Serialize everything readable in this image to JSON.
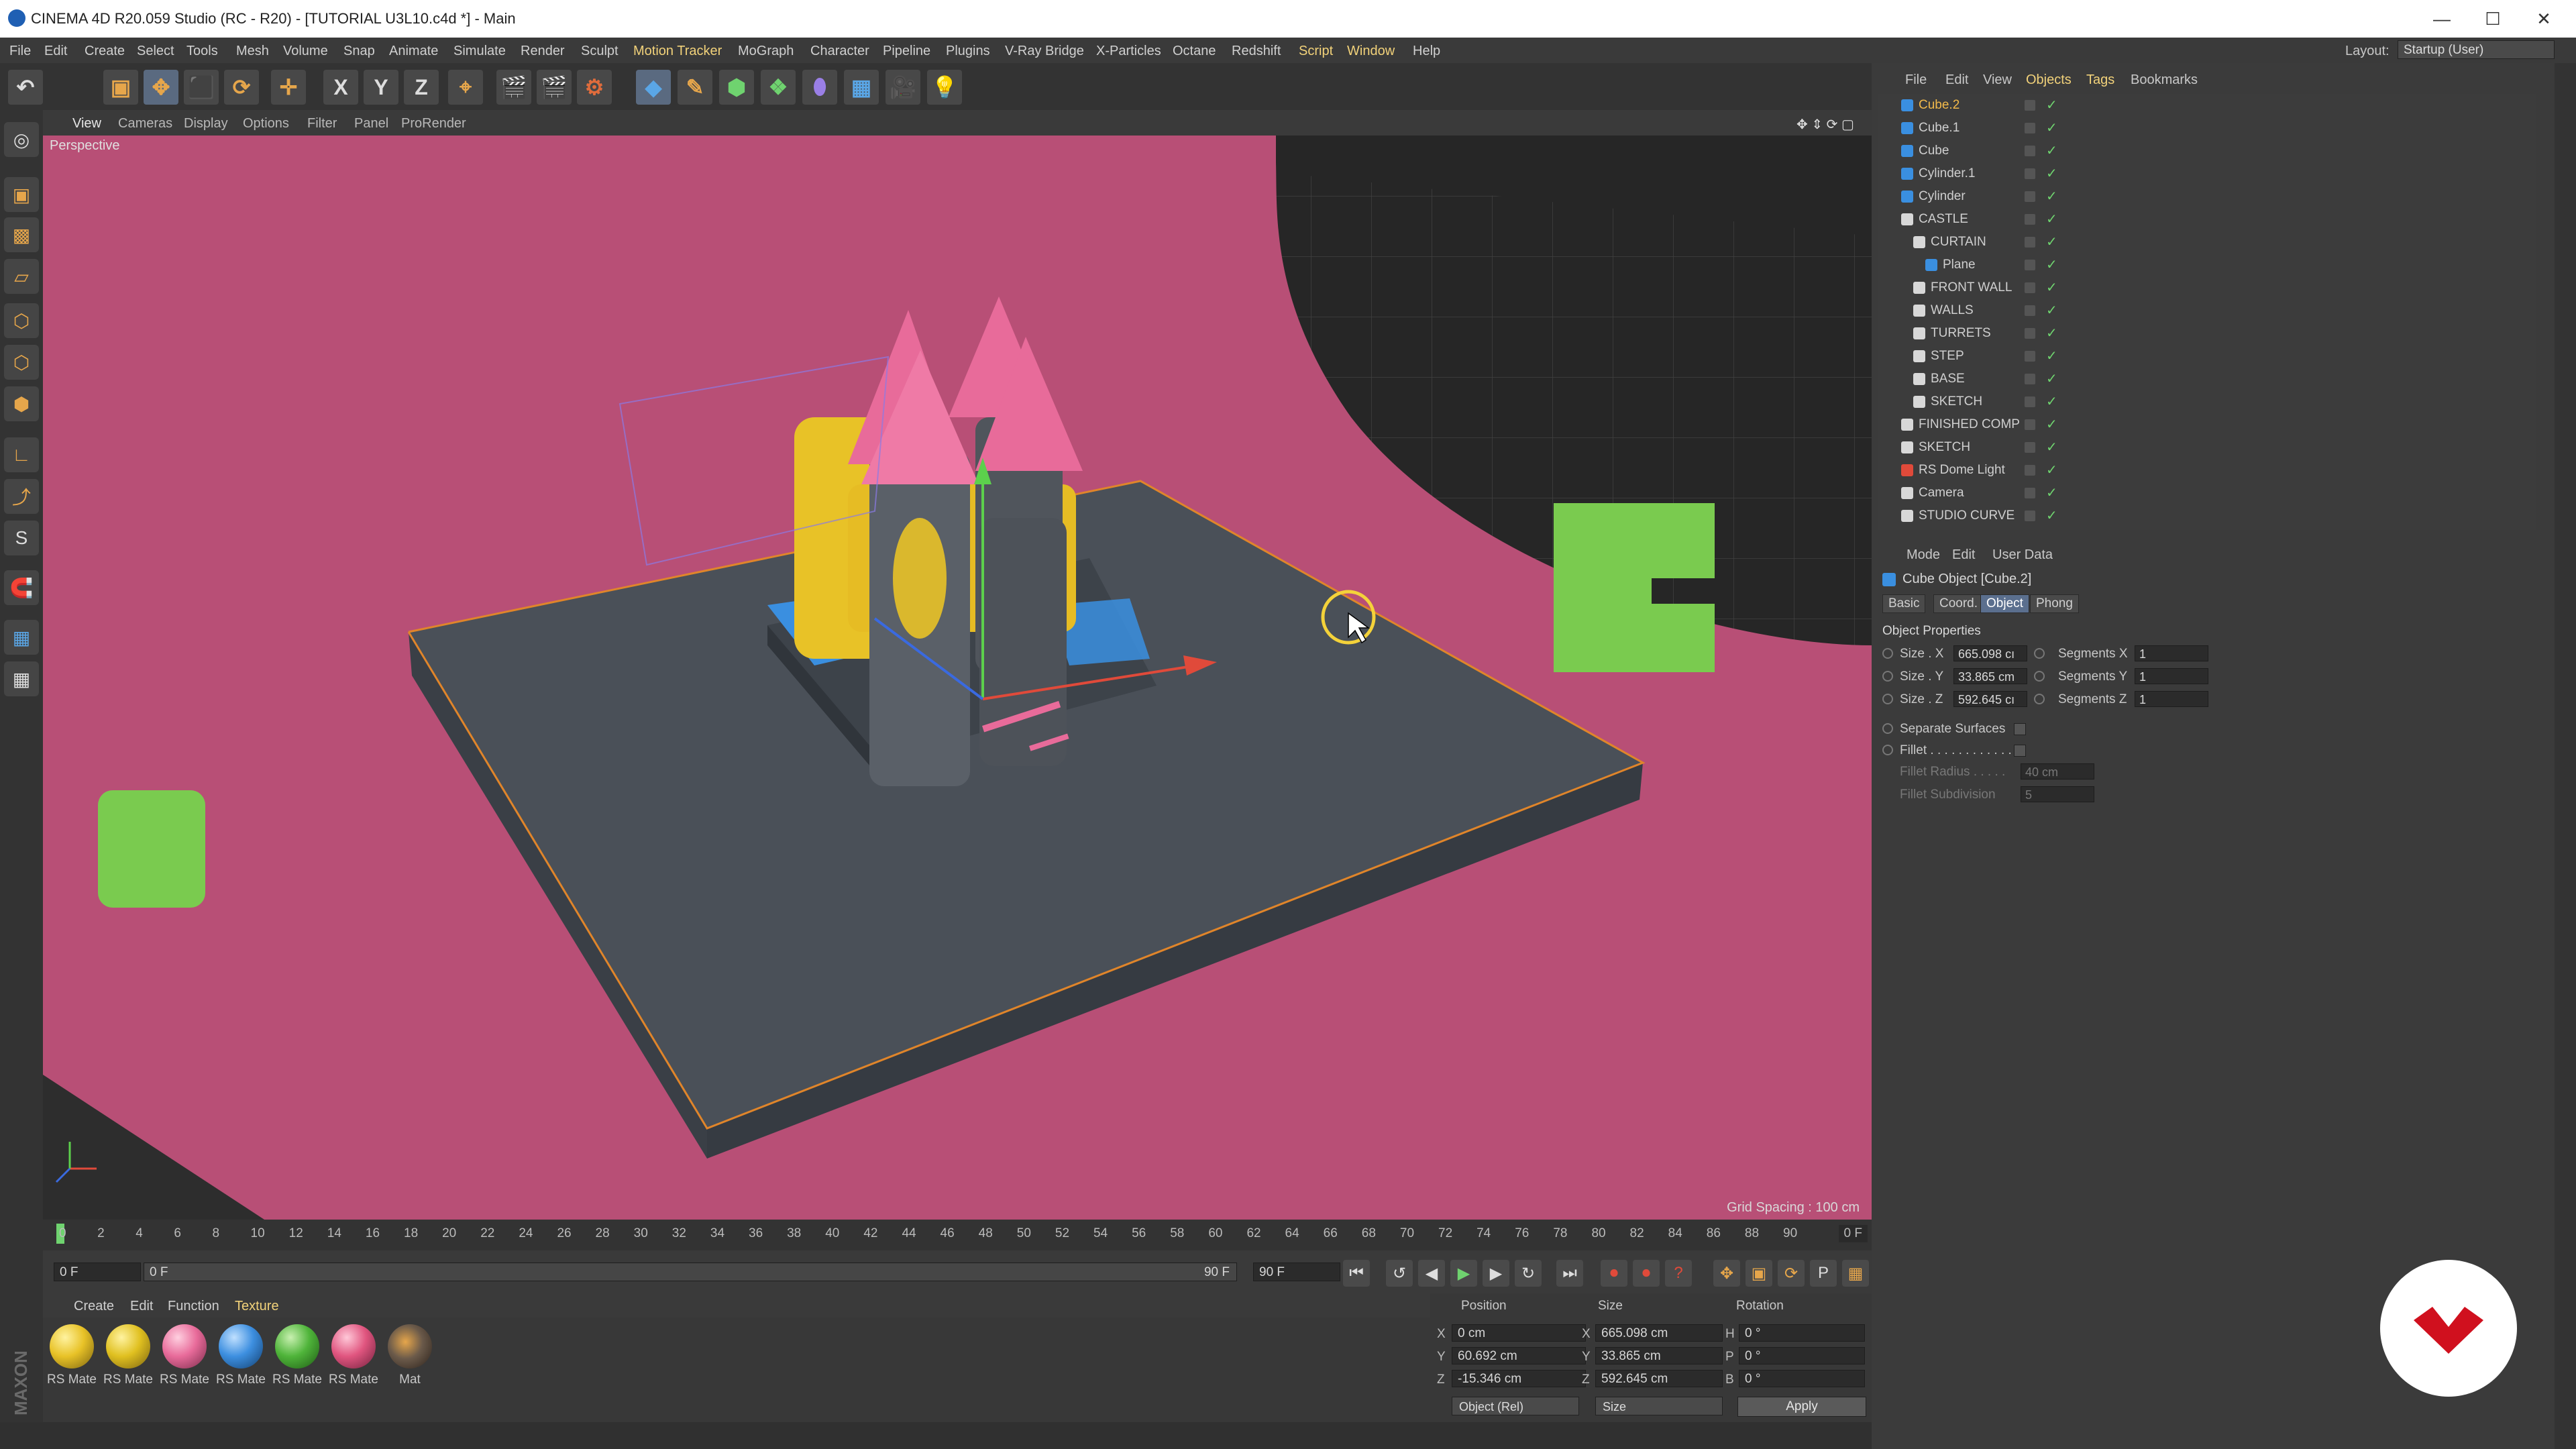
{
  "window": {
    "title": "CINEMA 4D R20.059 Studio (RC - R20) - [TUTORIAL U3L10.c4d *] - Main",
    "minimize": "—",
    "maximize": "☐",
    "close": "✕"
  },
  "menubar": {
    "items": [
      "File",
      "Edit",
      "Create",
      "Select",
      "Tools",
      "Mesh",
      "Volume",
      "Snap",
      "Animate",
      "Simulate",
      "Render",
      "Sculpt",
      "Motion Tracker",
      "MoGraph",
      "Character",
      "Pipeline",
      "Plugins",
      "V-Ray Bridge",
      "X-Particles",
      "Octane",
      "Redshift",
      "Script",
      "Window",
      "Help"
    ],
    "layout_label": "Layout:",
    "layout_value": "Startup (User)"
  },
  "toolbar": {
    "axis_x": "X",
    "axis_y": "Y",
    "axis_z": "Z"
  },
  "viewport": {
    "menu": [
      "View",
      "Cameras",
      "Display",
      "Options",
      "Filter",
      "Panel",
      "ProRender"
    ],
    "camera_label": "Perspective",
    "grid_spacing": "Grid Spacing : 100 cm",
    "colors": {
      "curtain": "#b84f76",
      "floor": "#2d2d2d",
      "base": "#4a5058",
      "turret_cap": "#e86b9a",
      "yellow": "#e8c227",
      "cube_green": "#7acb4f"
    }
  },
  "timeline": {
    "ticks": [
      "0",
      "2",
      "4",
      "6",
      "8",
      "10",
      "12",
      "14",
      "16",
      "18",
      "20",
      "22",
      "24",
      "26",
      "28",
      "30",
      "32",
      "34",
      "36",
      "38",
      "40",
      "42",
      "44",
      "46",
      "48",
      "50",
      "52",
      "54",
      "56",
      "58",
      "60",
      "62",
      "64",
      "66",
      "68",
      "70",
      "72",
      "74",
      "76",
      "78",
      "80",
      "82",
      "84",
      "86",
      "88",
      "90"
    ],
    "current_frame": "0 F",
    "start_field": "0 F",
    "slider_start": "0 F",
    "slider_end": "90 F",
    "end_field": "90 F"
  },
  "materials": {
    "menu": [
      "Create",
      "Edit",
      "Function",
      "Texture"
    ],
    "items": [
      {
        "label": "RS Mate",
        "color": "#e8c227"
      },
      {
        "label": "RS Mate",
        "color": "#e0c020"
      },
      {
        "label": "RS Mate",
        "color": "#e86b9a"
      },
      {
        "label": "RS Mate",
        "color": "#3d8fe0"
      },
      {
        "label": "RS Mate",
        "color": "#4fb43a"
      },
      {
        "label": "RS Mate",
        "color": "#e0557f"
      },
      {
        "label": "Mat",
        "color": "#6b5a4a"
      }
    ]
  },
  "coords": {
    "headers": {
      "position": "Position",
      "size": "Size",
      "rotation": "Rotation"
    },
    "rows": [
      {
        "axis": "X",
        "pos": "0 cm",
        "size_axis": "X",
        "size": "665.098 cm",
        "rot_axis": "H",
        "rot": "0 °"
      },
      {
        "axis": "Y",
        "pos": "60.692 cm",
        "size_axis": "Y",
        "size": "33.865 cm",
        "rot_axis": "P",
        "rot": "0 °"
      },
      {
        "axis": "Z",
        "pos": "-15.346 cm",
        "size_axis": "Z",
        "size": "592.645 cm",
        "rot_axis": "B",
        "rot": "0 °"
      }
    ],
    "mode_dropdown": "Object (Rel)",
    "size_dropdown": "Size",
    "apply": "Apply"
  },
  "object_manager": {
    "menu": [
      "File",
      "Edit",
      "View",
      "Objects",
      "Tags",
      "Bookmarks"
    ],
    "objects": [
      {
        "name": "Cube.2",
        "selected": true,
        "icon": "cube-icon",
        "indent": 0
      },
      {
        "name": "Cube.1",
        "selected": false,
        "icon": "cube-icon",
        "indent": 0
      },
      {
        "name": "Cube",
        "selected": false,
        "icon": "cube-icon",
        "indent": 0
      },
      {
        "name": "Cylinder.1",
        "selected": false,
        "icon": "cylinder-icon",
        "indent": 0
      },
      {
        "name": "Cylinder",
        "selected": false,
        "icon": "cylinder-icon",
        "indent": 0
      },
      {
        "name": "CASTLE",
        "selected": false,
        "icon": "null-icon",
        "indent": 0
      },
      {
        "name": "CURTAIN",
        "selected": false,
        "icon": "null-icon",
        "indent": 1
      },
      {
        "name": "Plane",
        "selected": false,
        "icon": "plane-icon",
        "indent": 2
      },
      {
        "name": "FRONT WALL",
        "selected": false,
        "icon": "null-icon",
        "indent": 1
      },
      {
        "name": "WALLS",
        "selected": false,
        "icon": "null-icon",
        "indent": 1
      },
      {
        "name": "TURRETS",
        "selected": false,
        "icon": "null-icon",
        "indent": 1
      },
      {
        "name": "STEP",
        "selected": false,
        "icon": "null-icon",
        "indent": 1
      },
      {
        "name": "BASE",
        "selected": false,
        "icon": "null-icon",
        "indent": 1
      },
      {
        "name": "SKETCH",
        "selected": false,
        "icon": "null-icon",
        "indent": 1
      },
      {
        "name": "FINISHED COMP",
        "selected": false,
        "icon": "null-icon",
        "indent": 0
      },
      {
        "name": "SKETCH",
        "selected": false,
        "icon": "null-icon",
        "indent": 0
      },
      {
        "name": "RS Dome Light",
        "selected": false,
        "icon": "light-icon",
        "indent": 0
      },
      {
        "name": "Camera",
        "selected": false,
        "icon": "camera-icon",
        "indent": 0
      },
      {
        "name": "STUDIO CURVE",
        "selected": false,
        "icon": "null-icon",
        "indent": 0
      }
    ]
  },
  "attributes": {
    "menu": [
      "Mode",
      "Edit",
      "User Data"
    ],
    "title": "Cube Object [Cube.2]",
    "tabs": [
      "Basic",
      "Coord.",
      "Object",
      "Phong"
    ],
    "active_tab": "Object",
    "section": "Object Properties",
    "props": [
      {
        "label": "Size . X",
        "value": "665.098 cı",
        "seg_label": "Segments X",
        "seg_value": "1"
      },
      {
        "label": "Size . Y",
        "value": "33.865 cm",
        "seg_label": "Segments Y",
        "seg_value": "1"
      },
      {
        "label": "Size . Z",
        "value": "592.645 cı",
        "seg_label": "Segments Z",
        "seg_value": "1"
      }
    ],
    "separate_surfaces": "Separate Surfaces",
    "fillet": "Fillet . . . . . . . . . . . .",
    "fillet_radius_label": "Fillet Radius . . . . .",
    "fillet_radius_value": "40 cm",
    "fillet_subdivision_label": "Fillet Subdivision",
    "fillet_subdivision_value": "5"
  }
}
